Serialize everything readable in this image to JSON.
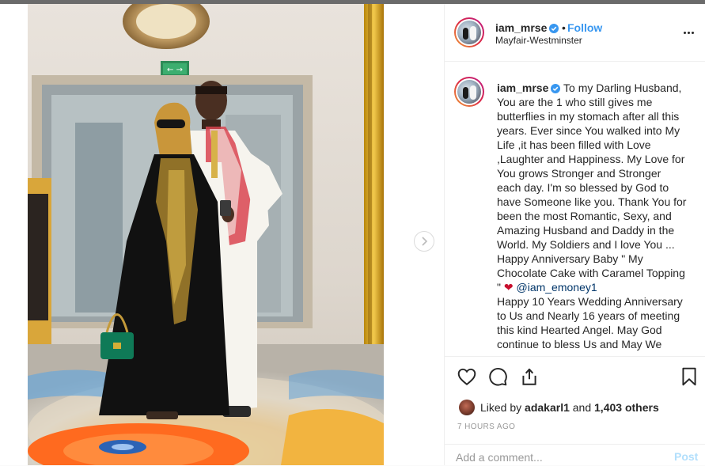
{
  "post": {
    "username": "iam_mrse",
    "follow_label": "Follow",
    "dot": "•",
    "location": "Mayfair-Westminster",
    "photo_alt": "Couple standing in a hotel lobby",
    "photo_sign_text": "← →"
  },
  "caption": {
    "username": "iam_mrse",
    "text_before_mention": "To my Darling Husband, You are the 1 who still gives me butterflies in my stomach after all this years. Ever since You walked into My Life ,it has been filled with Love ,Laughter and Happiness. My Love for You grows Stronger and Stronger each day. I'm so blessed by God to have Someone like you. Thank You for been the most Romantic, Sexy, and Amazing Husband and Daddy in the World. My Soldiers and I love You ... Happy Anniversary Baby \" My Chocolate Cake with Caramel Topping \"",
    "heart": "❤",
    "mention": "@iam_emoney1",
    "text_after_mention": "Happy 10 Years Wedding Anniversary to Us and Nearly 16 years of meeting this kind Hearted Angel. May God continue to bless Us and May We"
  },
  "likes": {
    "prefix": "Liked by",
    "user": "adakarl1",
    "joiner": "and",
    "count": "1,403 others"
  },
  "timestamp": "7 HOURS AGO",
  "comment_box": {
    "placeholder": "Add a comment...",
    "post_label": "Post"
  },
  "colors": {
    "accent": "#3897f0",
    "verified": "#3897f0",
    "post_disabled": "#b2dffc",
    "border": "#efefef"
  },
  "icons": [
    "verified-badge-icon",
    "more-options-icon",
    "heart-icon",
    "comment-icon",
    "share-icon",
    "bookmark-icon",
    "chevron-right-icon"
  ]
}
